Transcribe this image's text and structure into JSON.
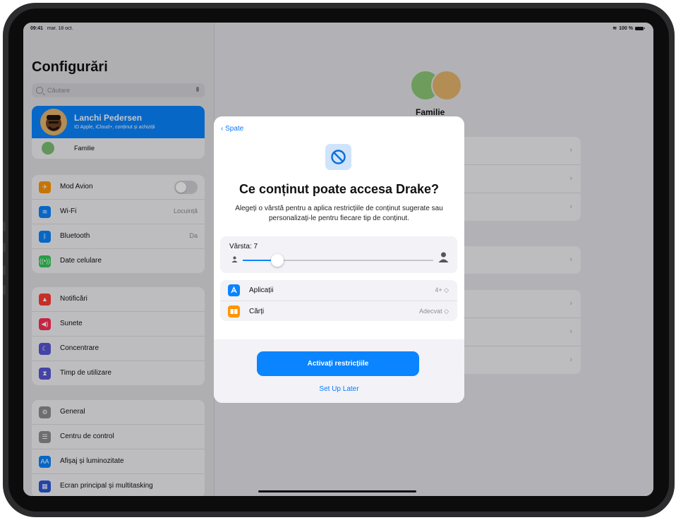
{
  "status": {
    "time": "09:41",
    "date": "mar. 18 oct.",
    "battery": "100 %"
  },
  "sidebar": {
    "title": "Configurări",
    "search_placeholder": "Căutare",
    "profile": {
      "name": "Lanchi Pedersen",
      "subtitle": "ID Apple, iCloud+, conținut și achiziții"
    },
    "family_label": "Familie",
    "group1": [
      {
        "label": "Mod Avion",
        "value": "",
        "color": "#ff9500"
      },
      {
        "label": "Wi-Fi",
        "value": "Locuință",
        "color": "#0a84ff"
      },
      {
        "label": "Bluetooth",
        "value": "Da",
        "color": "#0a84ff"
      },
      {
        "label": "Date celulare",
        "value": "",
        "color": "#34c759"
      }
    ],
    "group2": [
      {
        "label": "Notificări",
        "color": "#ff3b30"
      },
      {
        "label": "Sunete",
        "color": "#ff2d55"
      },
      {
        "label": "Concentrare",
        "color": "#5856d6"
      },
      {
        "label": "Timp de utilizare",
        "color": "#5856d6"
      }
    ],
    "group3": [
      {
        "label": "General",
        "color": "#8e8e93"
      },
      {
        "label": "Centru de control",
        "color": "#8e8e93"
      },
      {
        "label": "Afișaj și luminozitate",
        "color": "#0a84ff"
      },
      {
        "label": "Ecran principal și multitasking",
        "color": "#2c56d6"
      }
    ]
  },
  "detail": {
    "title": "Familie"
  },
  "modal": {
    "back_label": "Spate",
    "title": "Ce conținut poate accesa Drake?",
    "description": "Alegeți o vârstă pentru a aplica restricțiile de conținut sugerate sau personalizați-le pentru fiecare tip de conținut.",
    "age_label": "Vârsta: 7",
    "age_slider_fraction": 0.18,
    "categories": [
      {
        "label": "Aplicații",
        "value": "4+ ◇",
        "color": "#0a84ff"
      },
      {
        "label": "Cărți",
        "value": "Adecvat ◇",
        "color": "#ff9500"
      }
    ],
    "primary_button": "Activați restricțiile",
    "secondary_button": "Set Up Later"
  }
}
